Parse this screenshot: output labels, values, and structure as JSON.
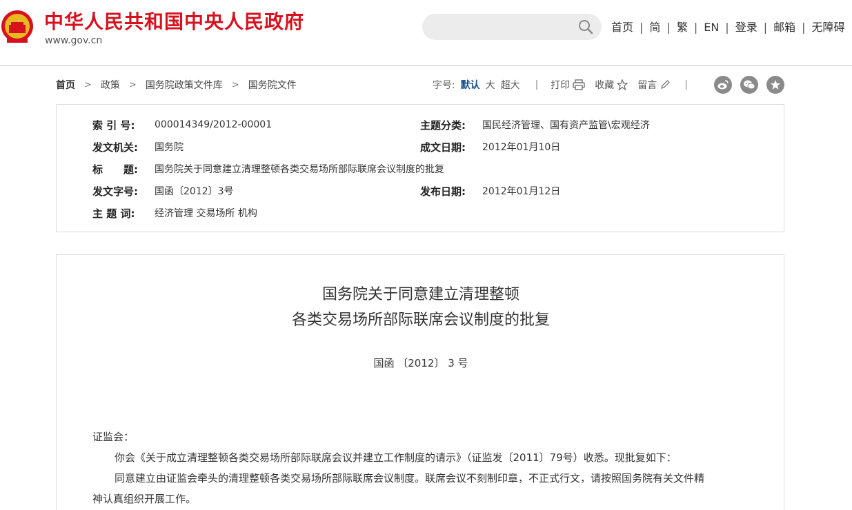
{
  "header": {
    "site_title": "中华人民共和国中央人民政府",
    "site_url": "www.gov.cn",
    "search_placeholder": "",
    "nav": [
      "首页",
      "简",
      "繁",
      "EN",
      "登录",
      "邮箱",
      "无障碍"
    ],
    "nav_separator": "|"
  },
  "breadcrumb": {
    "items": [
      "首页",
      "政策",
      "国务院政策文件库",
      "国务院文件"
    ],
    "separator": ">"
  },
  "tools": {
    "font_label": "字号:",
    "font_options": [
      "默认",
      "大",
      "超大"
    ],
    "print": "打印",
    "favorite": "收藏",
    "comment": "留言",
    "divider": "|",
    "share_icons": [
      "weibo-icon",
      "wechat-icon",
      "star-icon"
    ]
  },
  "info": {
    "index_label": "索 引 号:",
    "index_value": "000014349/2012-00001",
    "category_label": "主题分类:",
    "category_value": "国民经济管理、国有资产监管\\宏观经济",
    "issuer_label": "发文机关:",
    "issuer_value": "国务院",
    "created_label": "成文日期:",
    "created_value": "2012年01月10日",
    "title_label": "标　　题:",
    "title_value": "国务院关于同意建立清理整顿各类交易场所部际联席会议制度的批复",
    "docno_label": "发文字号:",
    "docno_value": "国函〔2012〕3号",
    "published_label": "发布日期:",
    "published_value": "2012年01月12日",
    "keywords_label": "主 题 词:",
    "keywords_value": "经济管理 交易场所 机构"
  },
  "document": {
    "title_line1": "国务院关于同意建立清理整顿",
    "title_line2": "各类交易场所部际联席会议制度的批复",
    "number": "国函 〔2012〕 3 号",
    "addressee": "证监会：",
    "para1": "你会《关于成立清理整顿各类交易场所部际联席会议并建立工作制度的请示》（证监发〔2011〕79号）收悉。现批复如下：",
    "para2_line1": "同意建立由证监会牵头的清理整顿各类交易场所部际联席会议制度。联席会议不刻制印章，不正式行文，请按照国务院有关文件精",
    "para2_line2": "神认真组织开展工作。"
  },
  "colors": {
    "brand_red": "#d7121e",
    "link_blue": "#1b4f8a",
    "border": "#dddddd"
  }
}
